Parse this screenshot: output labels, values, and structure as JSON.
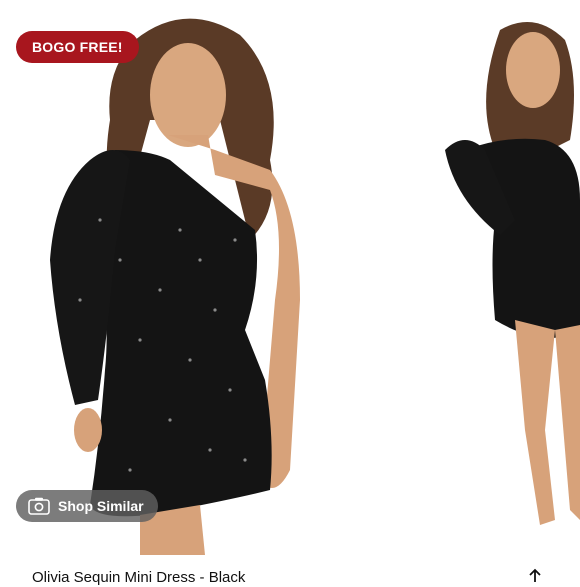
{
  "badge": {
    "label": "BOGO FREE!",
    "color": "#a8161e"
  },
  "shop_similar": {
    "label": "Shop Similar",
    "icon": "camera-icon"
  },
  "product": {
    "title": "Olivia Sequin Mini Dress - Black"
  },
  "share": {
    "icon": "share-icon"
  }
}
